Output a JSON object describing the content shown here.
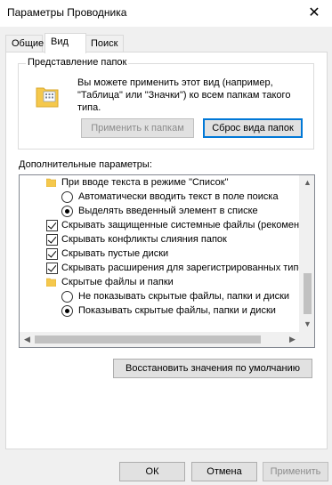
{
  "window": {
    "title": "Параметры Проводника",
    "close_glyph": "✕"
  },
  "tabs": [
    {
      "label": "Общие"
    },
    {
      "label": "Вид"
    },
    {
      "label": "Поиск"
    }
  ],
  "folder_views": {
    "legend": "Представление папок",
    "description": "Вы можете применить этот вид (например, \"Таблица\" или \"Значки\") ко всем папкам такого типа.",
    "apply_button": "Применить к папкам",
    "reset_button": "Сброс вида папок"
  },
  "advanced": {
    "label": "Дополнительные параметры:",
    "items": [
      {
        "type": "folder",
        "text": "При вводе текста в режиме \"Список\""
      },
      {
        "type": "radio",
        "checked": false,
        "text": "Автоматически вводить текст в поле поиска"
      },
      {
        "type": "radio",
        "checked": true,
        "text": "Выделять введенный элемент в списке"
      },
      {
        "type": "checkbox",
        "checked": true,
        "text": "Скрывать защищенные системные файлы (рекомен,"
      },
      {
        "type": "checkbox",
        "checked": true,
        "text": "Скрывать конфликты слияния папок"
      },
      {
        "type": "checkbox",
        "checked": true,
        "text": "Скрывать пустые диски"
      },
      {
        "type": "checkbox",
        "checked": true,
        "text": "Скрывать расширения для зарегистрированных типо"
      },
      {
        "type": "folder",
        "text": "Скрытые файлы и папки"
      },
      {
        "type": "radio",
        "checked": false,
        "text": "Не показывать скрытые файлы, папки и диски"
      },
      {
        "type": "radio",
        "checked": true,
        "text": "Показывать скрытые файлы, папки и диски"
      }
    ]
  },
  "restore_button": "Восстановить значения по умолчанию",
  "footer": {
    "ok": "ОК",
    "cancel": "Отмена",
    "apply": "Применить"
  }
}
